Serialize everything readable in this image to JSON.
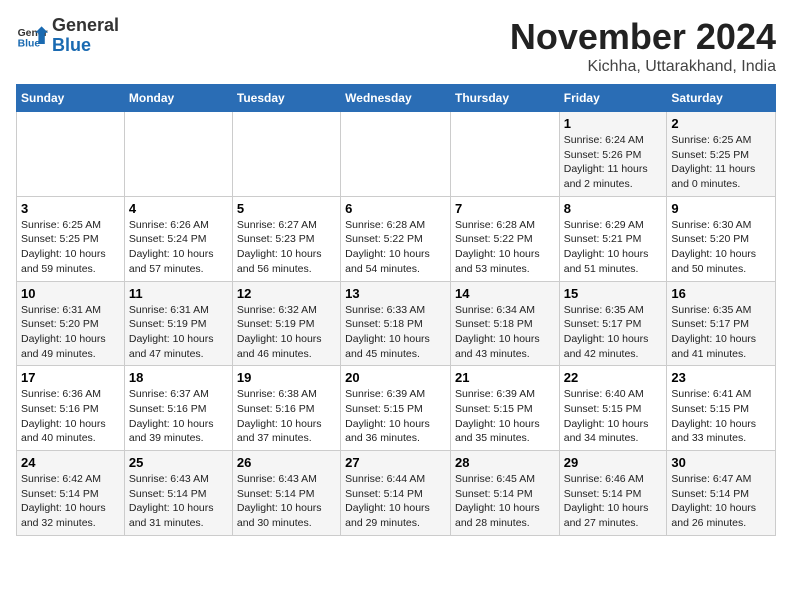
{
  "header": {
    "logo_general": "General",
    "logo_blue": "Blue",
    "month_title": "November 2024",
    "location": "Kichha, Uttarakhand, India"
  },
  "weekdays": [
    "Sunday",
    "Monday",
    "Tuesday",
    "Wednesday",
    "Thursday",
    "Friday",
    "Saturday"
  ],
  "weeks": [
    [
      {
        "day": "",
        "info": ""
      },
      {
        "day": "",
        "info": ""
      },
      {
        "day": "",
        "info": ""
      },
      {
        "day": "",
        "info": ""
      },
      {
        "day": "",
        "info": ""
      },
      {
        "day": "1",
        "info": "Sunrise: 6:24 AM\nSunset: 5:26 PM\nDaylight: 11 hours and 2 minutes."
      },
      {
        "day": "2",
        "info": "Sunrise: 6:25 AM\nSunset: 5:25 PM\nDaylight: 11 hours and 0 minutes."
      }
    ],
    [
      {
        "day": "3",
        "info": "Sunrise: 6:25 AM\nSunset: 5:25 PM\nDaylight: 10 hours and 59 minutes."
      },
      {
        "day": "4",
        "info": "Sunrise: 6:26 AM\nSunset: 5:24 PM\nDaylight: 10 hours and 57 minutes."
      },
      {
        "day": "5",
        "info": "Sunrise: 6:27 AM\nSunset: 5:23 PM\nDaylight: 10 hours and 56 minutes."
      },
      {
        "day": "6",
        "info": "Sunrise: 6:28 AM\nSunset: 5:22 PM\nDaylight: 10 hours and 54 minutes."
      },
      {
        "day": "7",
        "info": "Sunrise: 6:28 AM\nSunset: 5:22 PM\nDaylight: 10 hours and 53 minutes."
      },
      {
        "day": "8",
        "info": "Sunrise: 6:29 AM\nSunset: 5:21 PM\nDaylight: 10 hours and 51 minutes."
      },
      {
        "day": "9",
        "info": "Sunrise: 6:30 AM\nSunset: 5:20 PM\nDaylight: 10 hours and 50 minutes."
      }
    ],
    [
      {
        "day": "10",
        "info": "Sunrise: 6:31 AM\nSunset: 5:20 PM\nDaylight: 10 hours and 49 minutes."
      },
      {
        "day": "11",
        "info": "Sunrise: 6:31 AM\nSunset: 5:19 PM\nDaylight: 10 hours and 47 minutes."
      },
      {
        "day": "12",
        "info": "Sunrise: 6:32 AM\nSunset: 5:19 PM\nDaylight: 10 hours and 46 minutes."
      },
      {
        "day": "13",
        "info": "Sunrise: 6:33 AM\nSunset: 5:18 PM\nDaylight: 10 hours and 45 minutes."
      },
      {
        "day": "14",
        "info": "Sunrise: 6:34 AM\nSunset: 5:18 PM\nDaylight: 10 hours and 43 minutes."
      },
      {
        "day": "15",
        "info": "Sunrise: 6:35 AM\nSunset: 5:17 PM\nDaylight: 10 hours and 42 minutes."
      },
      {
        "day": "16",
        "info": "Sunrise: 6:35 AM\nSunset: 5:17 PM\nDaylight: 10 hours and 41 minutes."
      }
    ],
    [
      {
        "day": "17",
        "info": "Sunrise: 6:36 AM\nSunset: 5:16 PM\nDaylight: 10 hours and 40 minutes."
      },
      {
        "day": "18",
        "info": "Sunrise: 6:37 AM\nSunset: 5:16 PM\nDaylight: 10 hours and 39 minutes."
      },
      {
        "day": "19",
        "info": "Sunrise: 6:38 AM\nSunset: 5:16 PM\nDaylight: 10 hours and 37 minutes."
      },
      {
        "day": "20",
        "info": "Sunrise: 6:39 AM\nSunset: 5:15 PM\nDaylight: 10 hours and 36 minutes."
      },
      {
        "day": "21",
        "info": "Sunrise: 6:39 AM\nSunset: 5:15 PM\nDaylight: 10 hours and 35 minutes."
      },
      {
        "day": "22",
        "info": "Sunrise: 6:40 AM\nSunset: 5:15 PM\nDaylight: 10 hours and 34 minutes."
      },
      {
        "day": "23",
        "info": "Sunrise: 6:41 AM\nSunset: 5:15 PM\nDaylight: 10 hours and 33 minutes."
      }
    ],
    [
      {
        "day": "24",
        "info": "Sunrise: 6:42 AM\nSunset: 5:14 PM\nDaylight: 10 hours and 32 minutes."
      },
      {
        "day": "25",
        "info": "Sunrise: 6:43 AM\nSunset: 5:14 PM\nDaylight: 10 hours and 31 minutes."
      },
      {
        "day": "26",
        "info": "Sunrise: 6:43 AM\nSunset: 5:14 PM\nDaylight: 10 hours and 30 minutes."
      },
      {
        "day": "27",
        "info": "Sunrise: 6:44 AM\nSunset: 5:14 PM\nDaylight: 10 hours and 29 minutes."
      },
      {
        "day": "28",
        "info": "Sunrise: 6:45 AM\nSunset: 5:14 PM\nDaylight: 10 hours and 28 minutes."
      },
      {
        "day": "29",
        "info": "Sunrise: 6:46 AM\nSunset: 5:14 PM\nDaylight: 10 hours and 27 minutes."
      },
      {
        "day": "30",
        "info": "Sunrise: 6:47 AM\nSunset: 5:14 PM\nDaylight: 10 hours and 26 minutes."
      }
    ]
  ]
}
